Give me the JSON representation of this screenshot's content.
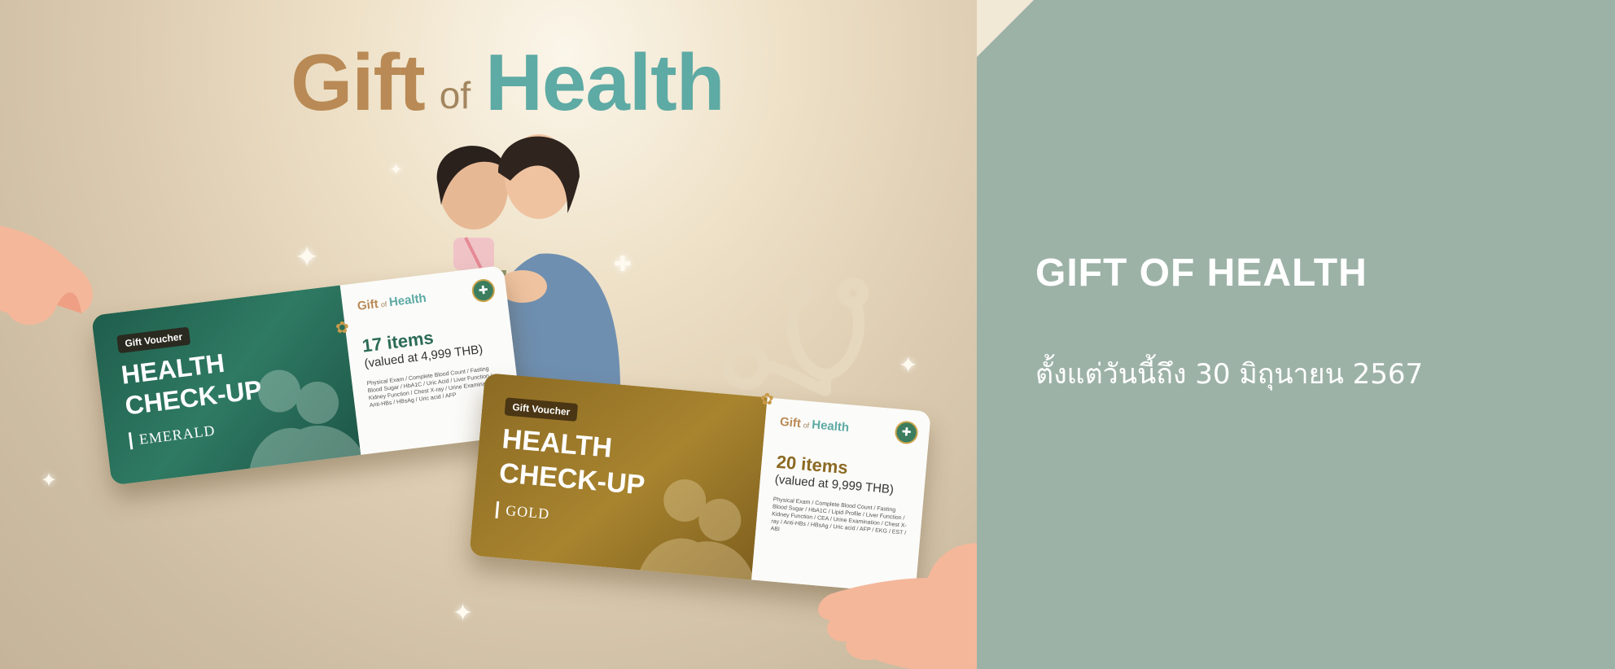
{
  "hero": {
    "title_gift": "Gift",
    "title_of": "of",
    "title_health": "Health"
  },
  "vouchers": [
    {
      "tag": "Gift Voucher",
      "title": "HEALTH\nCHECK-UP",
      "tier": "EMERALD",
      "brand": {
        "b1": "Gift",
        "b2": "of",
        "b3": "Health"
      },
      "items": "17 items",
      "value": "(valued at 4,999 THB)",
      "detail": "Physical Exam / Complete Blood Count / Fasting Blood Sugar / HbA1C / Uric Acid / Liver Function / Kidney Function / Chest X-ray / Urine Examination / Anti-HBs / HBsAg / Uric acid / AFP",
      "color": "#2f7a63"
    },
    {
      "tag": "Gift Voucher",
      "title": "HEALTH\nCHECK-UP",
      "tier": "GOLD",
      "brand": {
        "b1": "Gift",
        "b2": "of",
        "b3": "Health"
      },
      "items": "20 items",
      "value": "(valued at 9,999 THB)",
      "detail": "Physical Exam / Complete Blood Count / Fasting Blood Sugar / HbA1C / Lipid Profile / Liver Function / Kidney Function / CEA / Urine Examination / Chest X-ray / Anti-HBs / HBsAg / Uric acid / AFP / EKG / EST / ABI",
      "color": "#a8842f"
    }
  ],
  "info": {
    "title": "GIFT OF HEALTH",
    "date": "ตั้งแต่วันนี้ถึง 30 มิถุนายน 2567",
    "background": "#9db2a7"
  }
}
